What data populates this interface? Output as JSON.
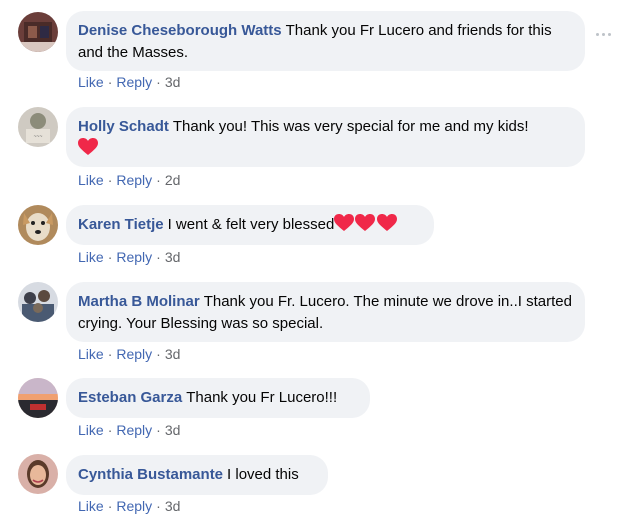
{
  "comments": [
    {
      "author": "Denise Cheseborough Watts",
      "text": "Thank you Fr Lucero and friends for this and the Masses.",
      "age": "3d"
    },
    {
      "author": "Holly Schadt",
      "text": "Thank you! This was very special for me and my kids!",
      "age": "2d",
      "emoji": "red-heart"
    },
    {
      "author": "Karen Tietje",
      "text": "I went & felt very blessed",
      "age": "3d",
      "emoji": "red-heart x3"
    },
    {
      "author": "Martha B Molinar",
      "text": "Thank you Fr. Lucero. The minute we drove in..I started crying. Your Blessing was so special.",
      "age": "3d"
    },
    {
      "author": "Esteban Garza",
      "text": "Thank you Fr Lucero!!!",
      "age": "3d"
    },
    {
      "author": "Cynthia Bustamante",
      "text": "I loved this",
      "age": "3d"
    }
  ],
  "actions": {
    "like": "Like",
    "reply": "Reply",
    "separator": "·"
  },
  "colors": {
    "author": "#385898",
    "link": "#4267b2",
    "bubble": "#f0f2f5",
    "heart": "#f02849"
  },
  "icons": {
    "more": "more-options-icon",
    "heart": "red-heart-icon"
  }
}
